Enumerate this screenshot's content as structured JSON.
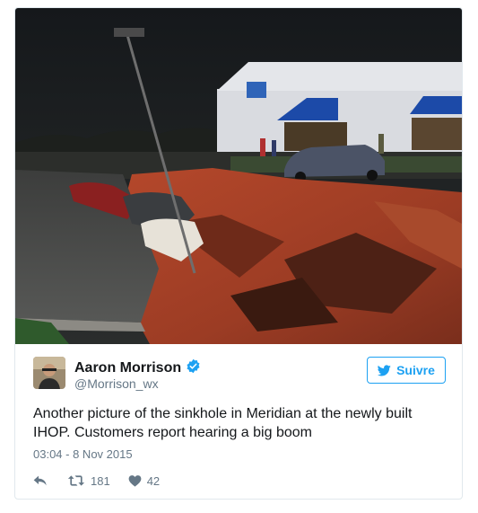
{
  "tweet": {
    "author_name": "Aaron Morrison",
    "author_handle": "@Morrison_wx",
    "verified": true,
    "follow_label": "Suivre",
    "text": "Another picture of the sinkhole in Meridian at the newly built IHOP. Customers report hearing a big boom",
    "timestamp": "03:04 - 8 Nov 2015",
    "retweets": "181",
    "likes": "42"
  },
  "icons": {
    "verified": "verified-badge-icon",
    "follow": "twitter-bird-icon",
    "reply": "reply-arrow-icon",
    "retweet": "retweet-icon",
    "like": "heart-icon"
  },
  "colors": {
    "accent": "#1da1f2",
    "text": "#14171a",
    "muted": "#657786",
    "border": "#e1e8ed"
  }
}
